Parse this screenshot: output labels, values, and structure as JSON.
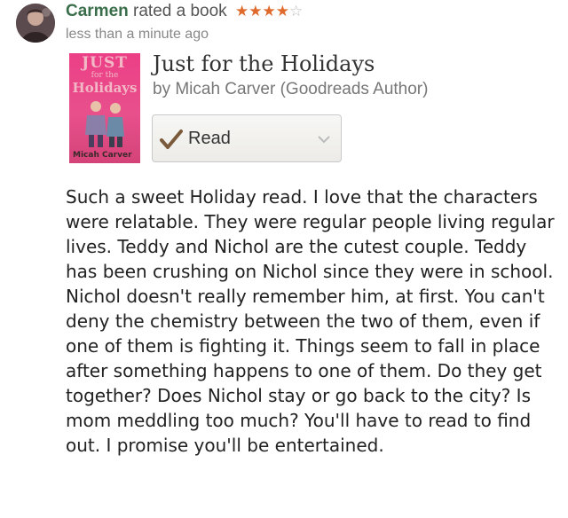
{
  "activity": {
    "user_name": "Carmen",
    "action_text": "rated a book",
    "rating": 4,
    "max_rating": 5,
    "timestamp": "less than a minute ago"
  },
  "book": {
    "title": "Just for the Holidays",
    "byline": "by Micah Carver (Goodreads Author)",
    "cover": {
      "title_line1": "JUST",
      "title_line2": "for the",
      "title_line3": "Holidays",
      "author": "Micah Carver"
    }
  },
  "shelf_button": {
    "label": "Read",
    "icon": "check-icon"
  },
  "review": {
    "text": "Such a sweet Holiday read. I love that the characters were relatable. They were regular people living regular lives. Teddy and Nichol are the cutest couple. Teddy has been crushing on Nichol since they were in school. Nichol doesn't really remember him, at first. You can't deny the chemistry between the two of them, even if one of them is fighting it. Things seem to fall in place after something happens to one of them. Do they get together? Does Nichol stay or go back to the city? Is mom meddling too much? You'll have to read to find out. I promise you'll be entertained."
  },
  "colors": {
    "user_name": "#3a6e4a",
    "star_filled": "#e06a2b",
    "check_mark": "#7a5a3a",
    "cover_pink": "#ec3f86"
  }
}
